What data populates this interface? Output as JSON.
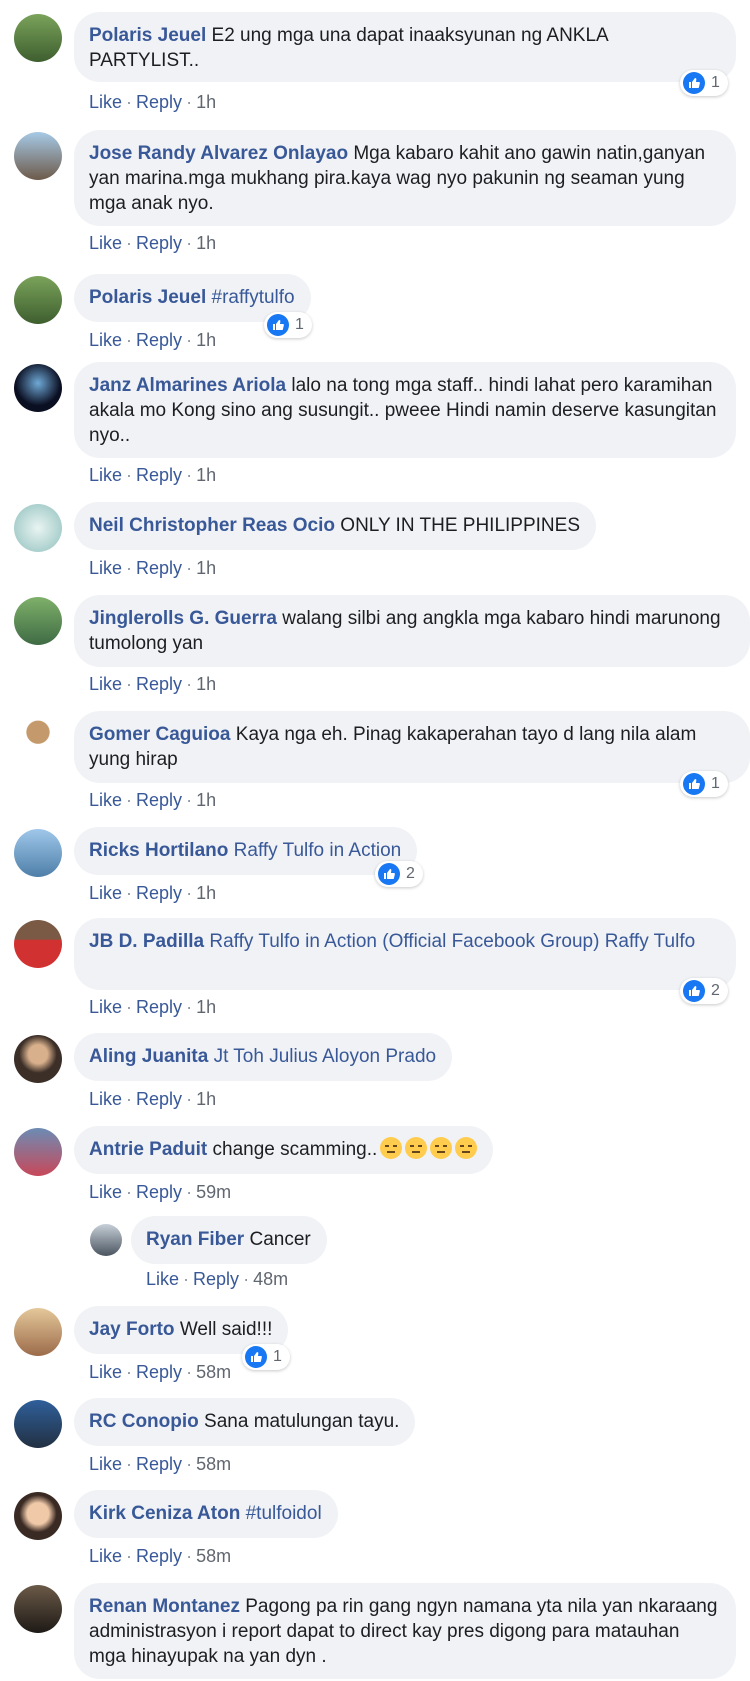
{
  "labels": {
    "like": "Like",
    "reply": "Reply",
    "dot": "·"
  },
  "colors": {
    "author": "#385898",
    "bubble": "#f0f2f5",
    "like_badge": "#1877f2"
  },
  "comments": [
    {
      "author": "Polaris Jeuel",
      "text": "E2 ung mga una dapat inaaksyunan ng ANKLA PARTYLIST..",
      "time": "1h",
      "reactions": "1"
    },
    {
      "author": "Jose Randy Alvarez Onlayao",
      "text": "Mga kabaro kahit ano gawin natin,ganyan yan marina.mga mukhang pira.kaya wag nyo pakunin ng seaman yung mga anak nyo.",
      "time": "1h"
    },
    {
      "author": "Polaris Jeuel",
      "text": "#raffytulfo",
      "time": "1h",
      "reactions": "1"
    },
    {
      "author": "Janz Almarines Ariola",
      "text": "lalo na tong mga staff.. hindi lahat pero karamihan akala mo Kong sino ang susungit.. pweee Hindi namin deserve kasungitan nyo..",
      "time": "1h"
    },
    {
      "author": "Neil Christopher Reas Ocio",
      "text": "ONLY IN THE PHILIPPINES",
      "time": "1h"
    },
    {
      "author": "Jinglerolls G. Guerra",
      "text": "walang silbi ang angkla mga kabaro hindi marunong tumolong yan",
      "time": "1h"
    },
    {
      "author": "Gomer Caguioa",
      "text": "Kaya nga eh. Pinag kakaperahan tayo d lang nila alam yung hirap",
      "time": "1h",
      "reactions": "1"
    },
    {
      "author": "Ricks Hortilano",
      "text": "Raffy Tulfo in Action",
      "time": "1h",
      "reactions": "2"
    },
    {
      "author": "JB D. Padilla",
      "text": "Raffy Tulfo in Action (Official Facebook Group) Raffy Tulfo",
      "time": "1h",
      "reactions": "2"
    },
    {
      "author": "Aling Juanita",
      "text": "Jt Toh Julius Aloyon Prado",
      "time": "1h"
    },
    {
      "author": "Antrie Paduit",
      "text": "change scamming..",
      "time": "59m"
    },
    {
      "author": "Ryan Fiber",
      "text": "Cancer",
      "time": "48m"
    },
    {
      "author": "Jay Forto",
      "text": "Well said!!!",
      "time": "58m",
      "reactions": "1"
    },
    {
      "author": "RC Conopio",
      "text": "Sana matulungan tayu.",
      "time": "58m"
    },
    {
      "author": "Kirk Ceniza Aton",
      "text": "#tulfoidol",
      "time": "58m"
    },
    {
      "author": "Renan Montanez",
      "text": "Pagong pa rin gang ngyn namana yta nila yan nkaraang administrasyon i report dapat to direct kay pres digong para matauhan mga hinayupak na yan dyn .",
      "time": ""
    }
  ]
}
